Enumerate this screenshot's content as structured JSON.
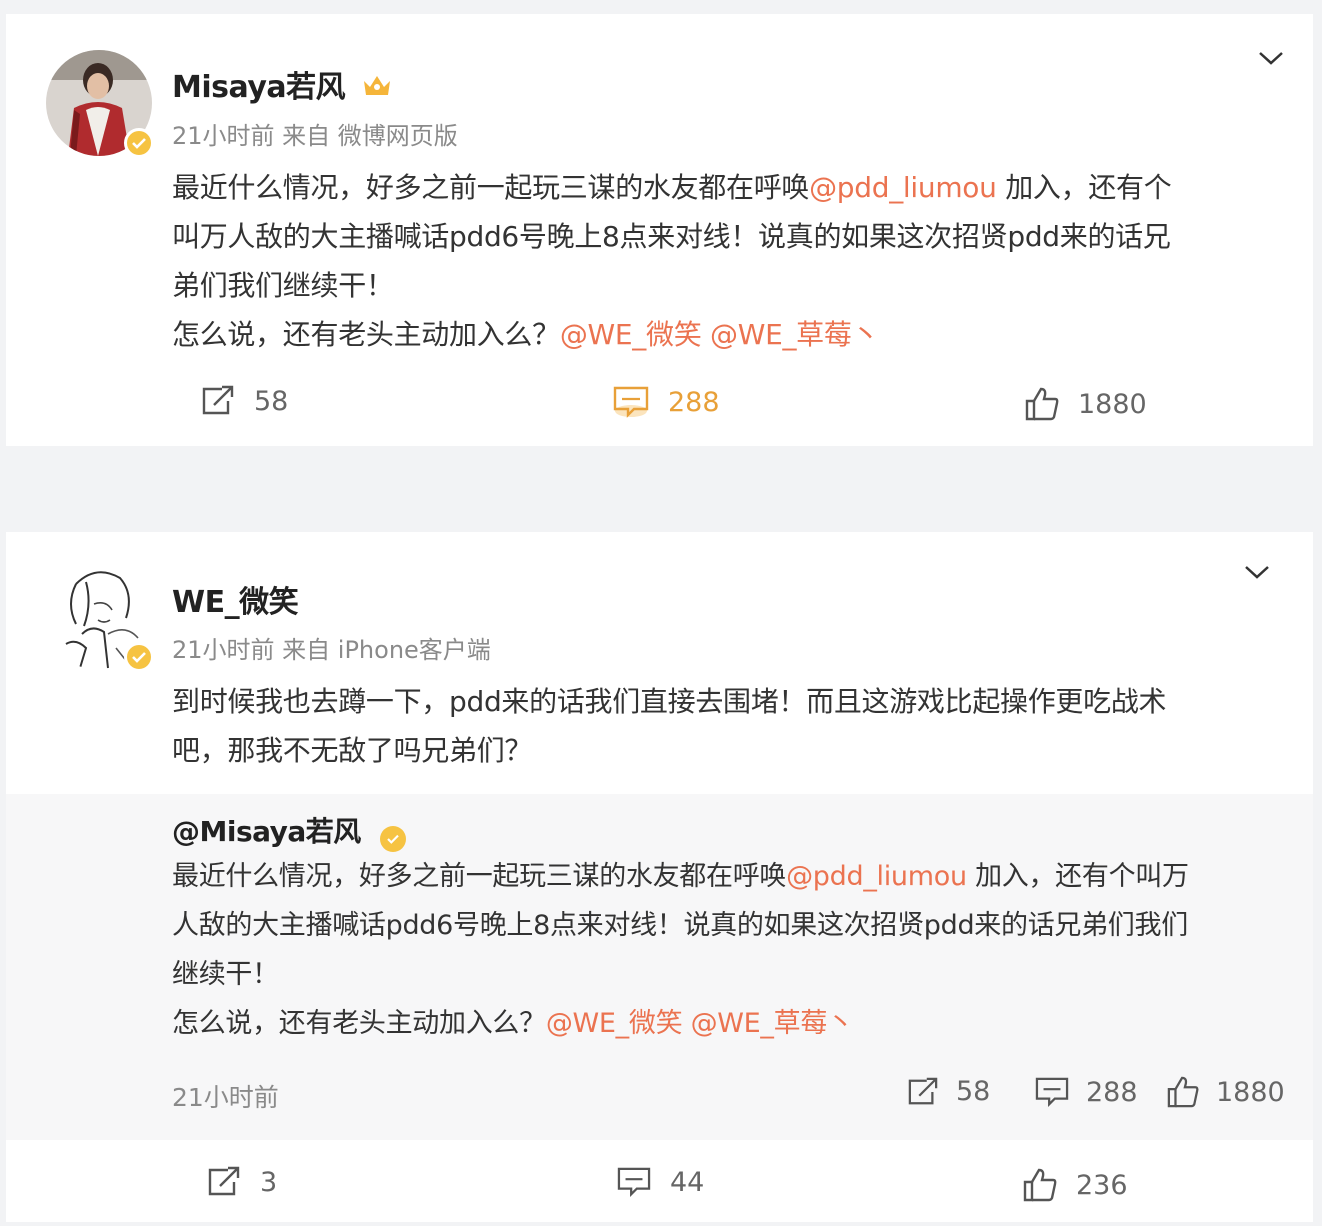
{
  "post1": {
    "username": "Misaya若风",
    "meta": "21小时前  来自 微博网页版",
    "line1_pre": "最近什么情况，好多之前一起玩三谋的水友都在呼唤",
    "line1_at": "@pdd_liumou",
    "line1_post": " 加入，还有个",
    "line2": "叫万人敌的大主播喊话pdd6号晚上8点来对线！说真的如果这次招贤pdd来的话兄",
    "line3": "弟们我们继续干！",
    "line4_pre": "怎么说，还有老头主动加入么？",
    "line4_at1": "@WE_微笑",
    "line4_at2": "@WE_草莓丶",
    "repost_count": "58",
    "comment_count": "288",
    "like_count": "1880"
  },
  "post2": {
    "username": "WE_微笑",
    "meta": "21小时前  来自 iPhone客户端",
    "line1": "到时候我也去蹲一下，pdd来的话我们直接去围堵！而且这游戏比起操作更吃战术",
    "line2": "吧，那我不无敌了吗兄弟们？",
    "quote": {
      "author": "@Misaya若风",
      "line1_pre": "最近什么情况，好多之前一起玩三谋的水友都在呼唤",
      "line1_at": "@pdd_liumou",
      "line1_post": " 加入，还有个叫万",
      "line2": "人敌的大主播喊话pdd6号晚上8点来对线！说真的如果这次招贤pdd来的话兄弟们我们",
      "line3": "继续干！",
      "line4_pre": "怎么说，还有老头主动加入么？",
      "line4_at1": "@WE_微笑",
      "line4_at2": "@WE_草莓丶",
      "time": "21小时前",
      "repost_count": "58",
      "comment_count": "288",
      "like_count": "1880"
    },
    "repost_count": "3",
    "comment_count": "44",
    "like_count": "236"
  },
  "colors": {
    "mention": "#eb7350",
    "active": "#e8a038",
    "verified": "#f6c342"
  }
}
